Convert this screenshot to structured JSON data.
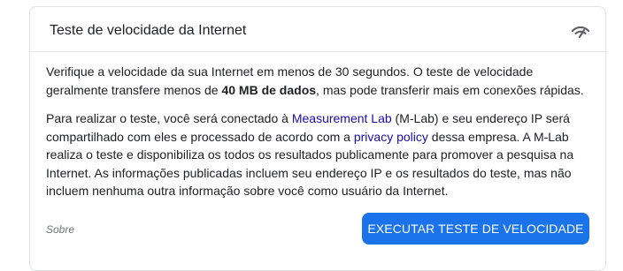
{
  "card": {
    "title": "Teste de velocidade da Internet",
    "icon": "speed-test-icon"
  },
  "intro": {
    "text_before": "Verifique a velocidade da sua Internet em menos de 30 segundos. O teste de velocidade geralmente transfere menos de ",
    "bold": "40 MB de dados",
    "text_after": ", mas pode transferir mais em conexões rápidas."
  },
  "details": {
    "part1": "Para realizar o teste, você será conectado à ",
    "link1": "Measurement Lab",
    "part2": " (M-Lab) e seu endereço IP será compartilhado com eles e processado de acordo com a ",
    "link2": "privacy policy",
    "part3": " dessa empresa. A M-Lab realiza o teste e disponibiliza os todos os resultados publicamente para promover a pesquisa na Internet. As informações publicadas incluem seu endereço IP e os resultados do teste, mas não incluem nenhuma outra informação sobre você como usuário da Internet."
  },
  "footer": {
    "about_label": "Sobre",
    "run_button_label": "EXECUTAR TESTE DE VELOCIDADE"
  },
  "colors": {
    "accent": "#1a73e8",
    "link": "#1a0dab"
  }
}
